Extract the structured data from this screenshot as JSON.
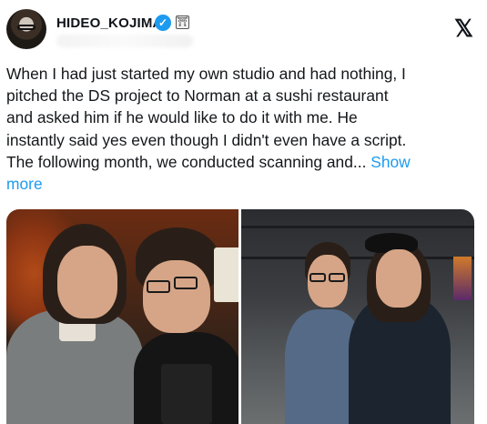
{
  "post": {
    "author": {
      "display_name": "HIDEO_KOJIMA",
      "verified_icon": "verified-badge-icon",
      "affiliation_icon": "affiliate-badge-icon"
    },
    "platform_icon": "x-logo-icon",
    "text_lines": [
      "When I had just started my own studio and had nothing, I",
      "pitched the DS project to Norman at a sushi restaurant",
      "and asked him if he would like to do it with me. He",
      "instantly said yes even though I didn't even have a script.",
      "The following month, we conducted scanning and... "
    ],
    "show_more_prefix": "Show",
    "show_more_suffix": "more",
    "colors": {
      "link": "#1d9bf0",
      "verified": "#1d9bf0",
      "text": "#14171a"
    },
    "media": [
      {
        "kind": "photo",
        "subject": "two men posing in a restaurant"
      },
      {
        "kind": "photo",
        "subject": "two men posing in a studio"
      }
    ]
  }
}
